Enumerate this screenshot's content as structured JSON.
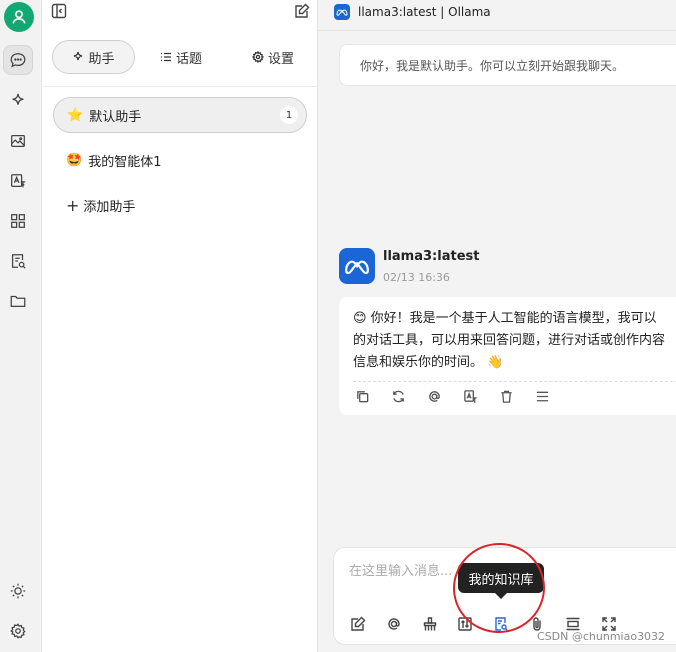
{
  "window": {
    "title": "llama3:latest | Ollama"
  },
  "tabs": {
    "assistant": "助手",
    "topics": "话题",
    "settings": "设置"
  },
  "assistants": [
    {
      "emoji": "⭐",
      "name": "默认助手",
      "count": "1"
    },
    {
      "emoji": "🤩",
      "name": "我的智能体1"
    }
  ],
  "add_assistant": "添加助手",
  "chat": {
    "greeting": "你好，我是默认助手。你可以立刻开始跟我聊天。",
    "model_name": "llama3:latest",
    "timestamp": "02/13 16:36",
    "reply_lines": [
      "😊 你好！我是一个基于人工智能的语言模型，我可以",
      "的对话工具，可以用来回答问题，进行对话或创作内容",
      "信息和娱乐你的时间。 👋"
    ]
  },
  "input": {
    "placeholder": "在这里输入消息..."
  },
  "tooltip": "我的知识库",
  "watermark": "CSDN @chunmiao3032",
  "colors": {
    "accent": "#12a873",
    "meta_blue": "#1a66d6",
    "annotation_red": "#d9252a"
  }
}
